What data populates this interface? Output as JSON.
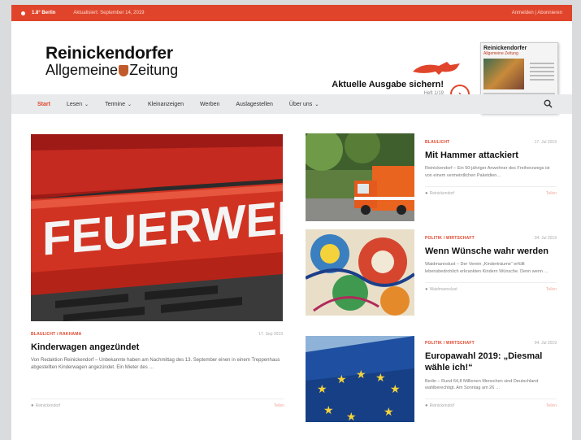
{
  "topbar": {
    "temperature": "1.8°  Berlin",
    "date": "Aktualisiert: September 14, 2019",
    "account": "Anmelden | Abonnieren"
  },
  "header": {
    "logo_line1": "Reinickendorfer",
    "logo_line2a": "Allgemeine",
    "logo_line2b": "Zeitung",
    "promo_title": "Aktuelle Ausgabe sichern!",
    "promo_sub": "Heft 1/19",
    "promo_arrow": "›",
    "paper_name": "Reinickendorfer",
    "paper_sub": "Allgemeine Zeitung"
  },
  "nav": {
    "items": [
      {
        "label": "Start",
        "dropdown": false,
        "active": true
      },
      {
        "label": "Lesen",
        "dropdown": true
      },
      {
        "label": "Termine",
        "dropdown": true
      },
      {
        "label": "Kleinanzeigen",
        "dropdown": false
      },
      {
        "label": "Werben",
        "dropdown": false
      },
      {
        "label": "Auslagestellen",
        "dropdown": false
      },
      {
        "label": "Über uns",
        "dropdown": true
      }
    ],
    "chevron": "⌄",
    "search_icon": "search-icon"
  },
  "hero": {
    "image_text": "FEUERWEHR",
    "category": "BLAULICHT / RAKHAMA",
    "date": "17. Sep 2019",
    "title": "Kinderwagen angezündet",
    "text": "Von Redaktion Reinickendorf – Unbekannte haben am Nachmittag des 13. September einen in einem Treppenhaus abgestellten Kinderwagen angezündet. Ein Mieter des …",
    "location": "Reinickendorf",
    "share": "Teilen"
  },
  "articles": [
    {
      "category": "BLAULICHT",
      "date": "17. Jul 2019",
      "title": "Mit Hammer attackiert",
      "text": "Reinickendorf – Ein 50-jähriger Anwohner des Freiherzwegs ist von einem vermeintlichen Paketdien…",
      "location": "Reinickendorf",
      "share": "Teilen"
    },
    {
      "category": "POLITIK / WIRTSCHAFT",
      "date": "04. Jul 2019",
      "title": "Wenn Wünsche wahr werden",
      "text": "Waidmannslust – Der Verein „Kinderträume“ erfüllt lebensbedrohlich erkrankten Kindern Wünsche. Denn wenn …",
      "location": "Waidmannslust",
      "share": "Teilen"
    },
    {
      "category": "POLITIK / WIRTSCHAFT",
      "date": "04. Jul 2019",
      "title": "Europawahl 2019: „Diesmal wähle ich!“",
      "text": "Berlin – Rund 64,8 Millionen Menschen sind Deutschland wahlberechtigt. Am Sonntag am 26 …",
      "location": "Reinickendorf",
      "share": "Teilen"
    }
  ],
  "colors": {
    "accent": "#e0452b",
    "nav_bg": "#e8eaec"
  }
}
